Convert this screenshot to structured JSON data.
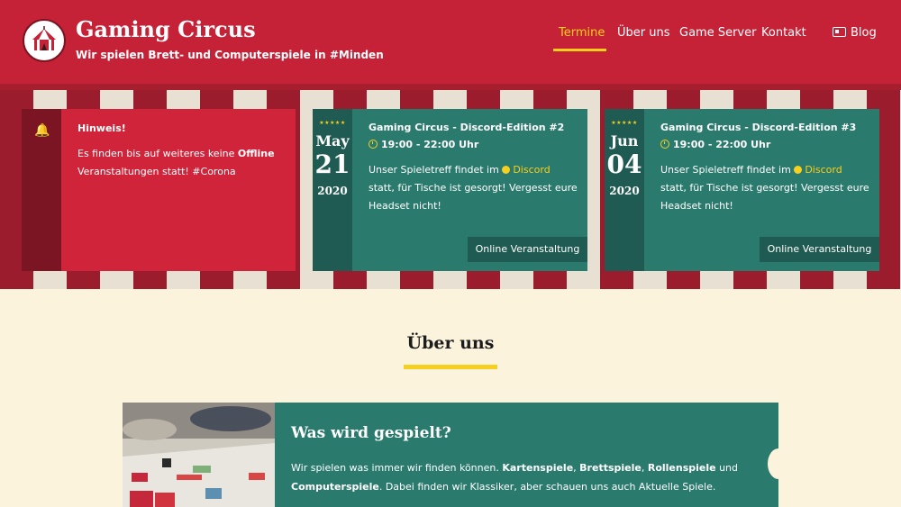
{
  "header": {
    "brand_title": "Gaming Circus",
    "brand_subtitle": "Wir spielen Brett- und Computerspiele in #Minden",
    "colors": {
      "primary": "#c52237",
      "accent": "#f6cf1f"
    }
  },
  "nav": {
    "items": [
      {
        "label": "Termine",
        "active": true
      },
      {
        "label": "Über uns",
        "active": false
      },
      {
        "label": "Game Server",
        "active": false
      },
      {
        "label": "Kontakt",
        "active": false
      },
      {
        "label": "Blog",
        "icon": "newspaper-icon",
        "active": false
      }
    ]
  },
  "notice": {
    "icon": "bell-icon",
    "title": "Hinweis!",
    "text_before": "Es finden bis auf weiteres keine ",
    "text_bold": "Offline",
    "text_after": " Veranstaltungen statt! #Corona"
  },
  "events": [
    {
      "stars": "★★★★★",
      "month": "May",
      "day": "21",
      "year": "2020",
      "title": "Gaming Circus - Discord-Edition #2",
      "time": "19:00 - 22:00 Uhr",
      "desc_before": "Unser Spieletreff findet im ",
      "desc_link": "Discord",
      "desc_after": " statt, für Tische ist gesorgt! Vergesst eure Headset nicht!",
      "button": "Online Veranstaltung"
    },
    {
      "stars": "★★★★★",
      "month": "Jun",
      "day": "04",
      "year": "2020",
      "title": "Gaming Circus - Discord-Edition #3",
      "time": "19:00 - 22:00 Uhr",
      "desc_before": "Unser Spieletreff findet im ",
      "desc_link": "Discord",
      "desc_after": " statt, für Tische ist gesorgt! Vergesst eure Headset nicht!",
      "button": "Online Veranstaltung"
    }
  ],
  "about": {
    "title": "Über uns",
    "card_heading": "Was wird gespielt?",
    "text_1": "Wir spielen was immer wir finden können. ",
    "bold_1": "Kartenspiele",
    "sep_1": ", ",
    "bold_2": "Brettspiele",
    "sep_2": ", ",
    "bold_3": "Rollenspiele",
    "sep_3": " und ",
    "bold_4": "Computerspiele",
    "text_2": ". Dabei finden wir Klassiker, aber schauen uns auch Aktuelle Spiele."
  }
}
